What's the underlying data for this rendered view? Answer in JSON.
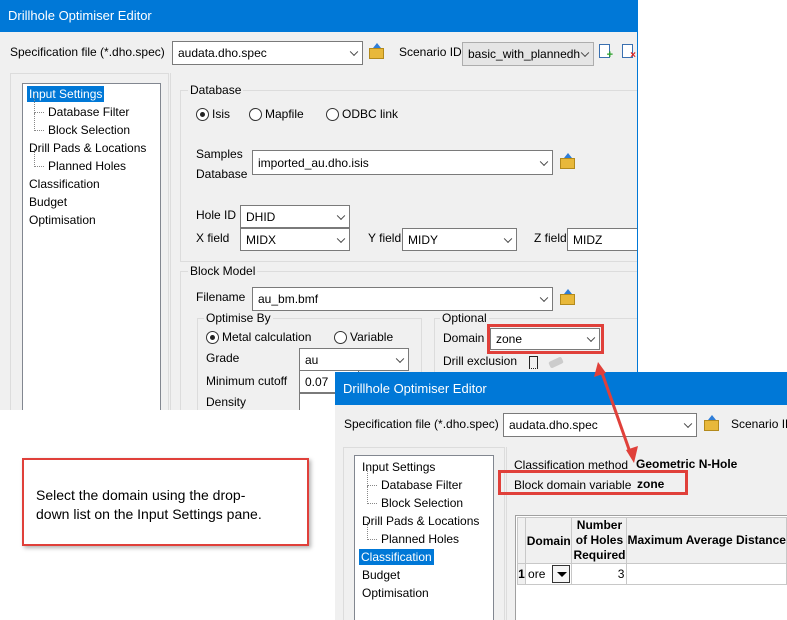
{
  "colors": {
    "accent": "#0078d7",
    "highlight_red": "#e0403a"
  },
  "window1": {
    "title": "Drillhole Optimiser Editor",
    "spec_label": "Specification file (*.dho.spec)",
    "spec_value": "audata.dho.spec",
    "scenario_label": "Scenario ID",
    "scenario_value": "basic_with_plannedh",
    "tree": [
      "Input Settings",
      "Database Filter",
      "Block Selection",
      "Drill Pads & Locations",
      "Planned Holes",
      "Classification",
      "Budget",
      "Optimisation"
    ],
    "database": {
      "group": "Database",
      "radios": [
        "Isis",
        "Mapfile",
        "ODBC link"
      ],
      "selected": "Isis",
      "samples_label_1": "Samples",
      "samples_label_2": "Database",
      "samples_value": "imported_au.dho.isis",
      "hole_id_label": "Hole ID",
      "hole_id": "DHID",
      "x_label": "X field",
      "x": "MIDX",
      "y_label": "Y field",
      "y": "MIDY",
      "z_label": "Z field",
      "z": "MIDZ"
    },
    "block_model": {
      "group": "Block Model",
      "filename_label": "Filename",
      "filename": "au_bm.bmf",
      "optimise_group": "Optimise By",
      "radios": [
        "Metal calculation",
        "Variable"
      ],
      "selected": "Metal calculation",
      "grade_label": "Grade",
      "grade": "au",
      "cutoff_label": "Minimum cutoff",
      "cutoff": "0.07",
      "density_label": "Density",
      "optional_group": "Optional",
      "domain_label": "Domain",
      "domain": "zone",
      "drill_exclusion_label": "Drill exclusion"
    }
  },
  "window2": {
    "title": "Drillhole Optimiser Editor",
    "spec_label": "Specification file (*.dho.spec)",
    "spec_value": "audata.dho.spec",
    "scenario_label": "Scenario ID",
    "tree": [
      "Input Settings",
      "Database Filter",
      "Block Selection",
      "Drill Pads & Locations",
      "Planned Holes",
      "Classification",
      "Budget",
      "Optimisation"
    ],
    "selected_tree": "Classification",
    "method_label": "Classification method",
    "method_value": "Geometric N-Hole",
    "domain_var_label": "Block domain variable",
    "domain_var_value": "zone",
    "table": {
      "headers": [
        "Domain",
        "Number of Holes Required",
        "Maximum Average Distance"
      ],
      "rows": [
        {
          "num": "1",
          "domain": "ore",
          "holes": "3",
          "dist": ""
        }
      ]
    }
  },
  "callout": {
    "line1": "Select the domain using the drop-",
    "line2": "down list on the Input Settings pane."
  }
}
